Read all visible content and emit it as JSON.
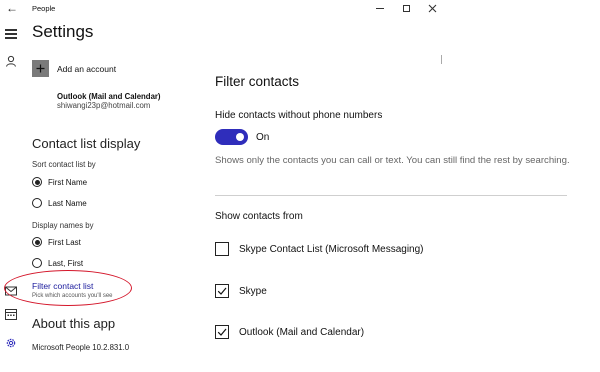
{
  "app": {
    "title": "People"
  },
  "left": {
    "page_title": "Settings",
    "add_account_label": "Add an account",
    "account_name": "Outlook (Mail and Calendar)",
    "account_email": "shiwangi23p@hotmail.com",
    "contact_list_display": "Contact list display",
    "sort_label": "Sort contact list by",
    "sort_options": [
      "First Name",
      "Last Name"
    ],
    "sort_selected": "First Name",
    "display_label": "Display names by",
    "display_options": [
      "First Last",
      "Last, First"
    ],
    "display_selected": "First Last",
    "filter_link_title": "Filter contact list",
    "filter_link_sub": "Pick which accounts you'll see",
    "about_title": "About this app",
    "version": "Microsoft People 10.2.831.0"
  },
  "right": {
    "title": "Filter contacts",
    "hide_label": "Hide contacts without phone numbers",
    "toggle_state": "On",
    "toggle_on": true,
    "description": "Shows only the contacts you can call or text. You can still find the rest by searching.",
    "show_from_label": "Show contacts from",
    "sources": [
      {
        "label": "Skype Contact List (Microsoft Messaging)",
        "checked": false
      },
      {
        "label": "Skype",
        "checked": true
      },
      {
        "label": "Outlook (Mail and Calendar)",
        "checked": true
      }
    ]
  },
  "icons": {
    "back": "back-arrow-icon",
    "menu": "hamburger-menu-icon",
    "contacts": "person-icon",
    "mail": "mail-icon",
    "calendar": "calendar-icon",
    "settings": "gear-icon"
  },
  "colors": {
    "accent": "#2f2dbb",
    "link": "#1a1a9c",
    "highlight": "#d4172b"
  }
}
